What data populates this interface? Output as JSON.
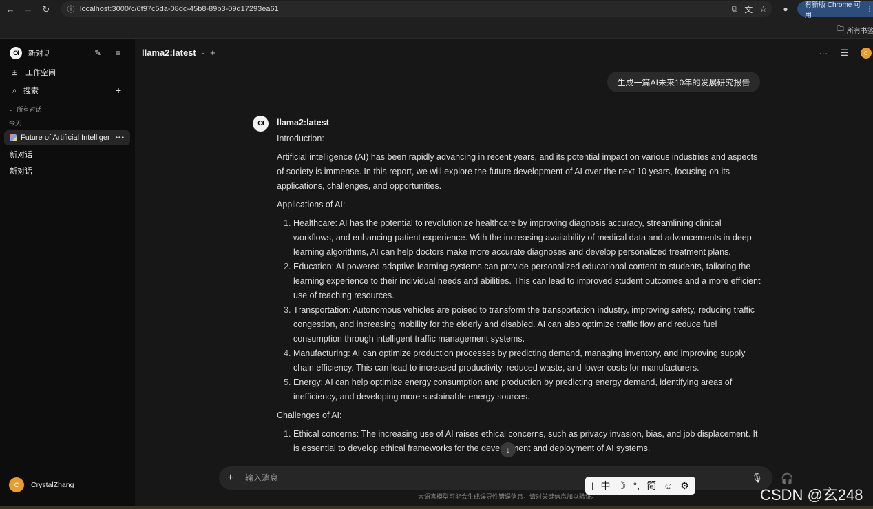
{
  "browser": {
    "url": "localhost:3000/c/6f97c5da-08dc-45b8-89b3-09d17293ea61",
    "update_label": "有新版 Chrome 可用",
    "bookmarks_folder": "所有书签"
  },
  "sidebar": {
    "new_chat": "新对话",
    "workspace": "工作空间",
    "search": "搜索",
    "all_chats": "所有对话",
    "today": "今天",
    "chats": [
      {
        "title": "Future of Artificial Intelligence"
      },
      {
        "title": "新对话"
      },
      {
        "title": "新对话"
      }
    ],
    "user": {
      "name": "CrystalZhang",
      "initial": "C"
    }
  },
  "header": {
    "model": "llama2:latest",
    "avatar_initial": "C"
  },
  "user_message": "生成一篇AI未来10年的发展研究报告",
  "assistant": {
    "name": "llama2:latest",
    "intro_heading": "Introduction:",
    "intro": "Artificial intelligence (AI) has been rapidly advancing in recent years, and its potential impact on various industries and aspects of society is immense. In this report, we will explore the future development of AI over the next 10 years, focusing on its applications, challenges, and opportunities.",
    "applications_heading": "Applications of AI:",
    "applications": [
      "Healthcare: AI has the potential to revolutionize healthcare by improving diagnosis accuracy, streamlining clinical workflows, and enhancing patient experience. With the increasing availability of medical data and advancements in deep learning algorithms, AI can help doctors make more accurate diagnoses and develop personalized treatment plans.",
      "Education: AI-powered adaptive learning systems can provide personalized educational content to students, tailoring the learning experience to their individual needs and abilities. This can lead to improved student outcomes and a more efficient use of teaching resources.",
      "Transportation: Autonomous vehicles are poised to transform the transportation industry, improving safety, reducing traffic congestion, and increasing mobility for the elderly and disabled. AI can also optimize traffic flow and reduce fuel consumption through intelligent traffic management systems.",
      "Manufacturing: AI can optimize production processes by predicting demand, managing inventory, and improving supply chain efficiency. This can lead to increased productivity, reduced waste, and lower costs for manufacturers.",
      "Energy: AI can help optimize energy consumption and production by predicting energy demand, identifying areas of inefficiency, and developing more sustainable energy sources."
    ],
    "challenges_heading": "Challenges of AI:",
    "challenges": [
      "Ethical concerns: The increasing use of AI raises ethical concerns, such as privacy invasion, bias, and job displacement. It is essential to develop ethical frameworks for the development and deployment of AI systems."
    ]
  },
  "composer": {
    "placeholder": "输入消息",
    "disclaimer": "大语言模型可能会生成误导性错误信息，请对关键信息加以验证。"
  },
  "ime": [
    "中",
    "简"
  ],
  "watermark": "CSDN @玄248"
}
